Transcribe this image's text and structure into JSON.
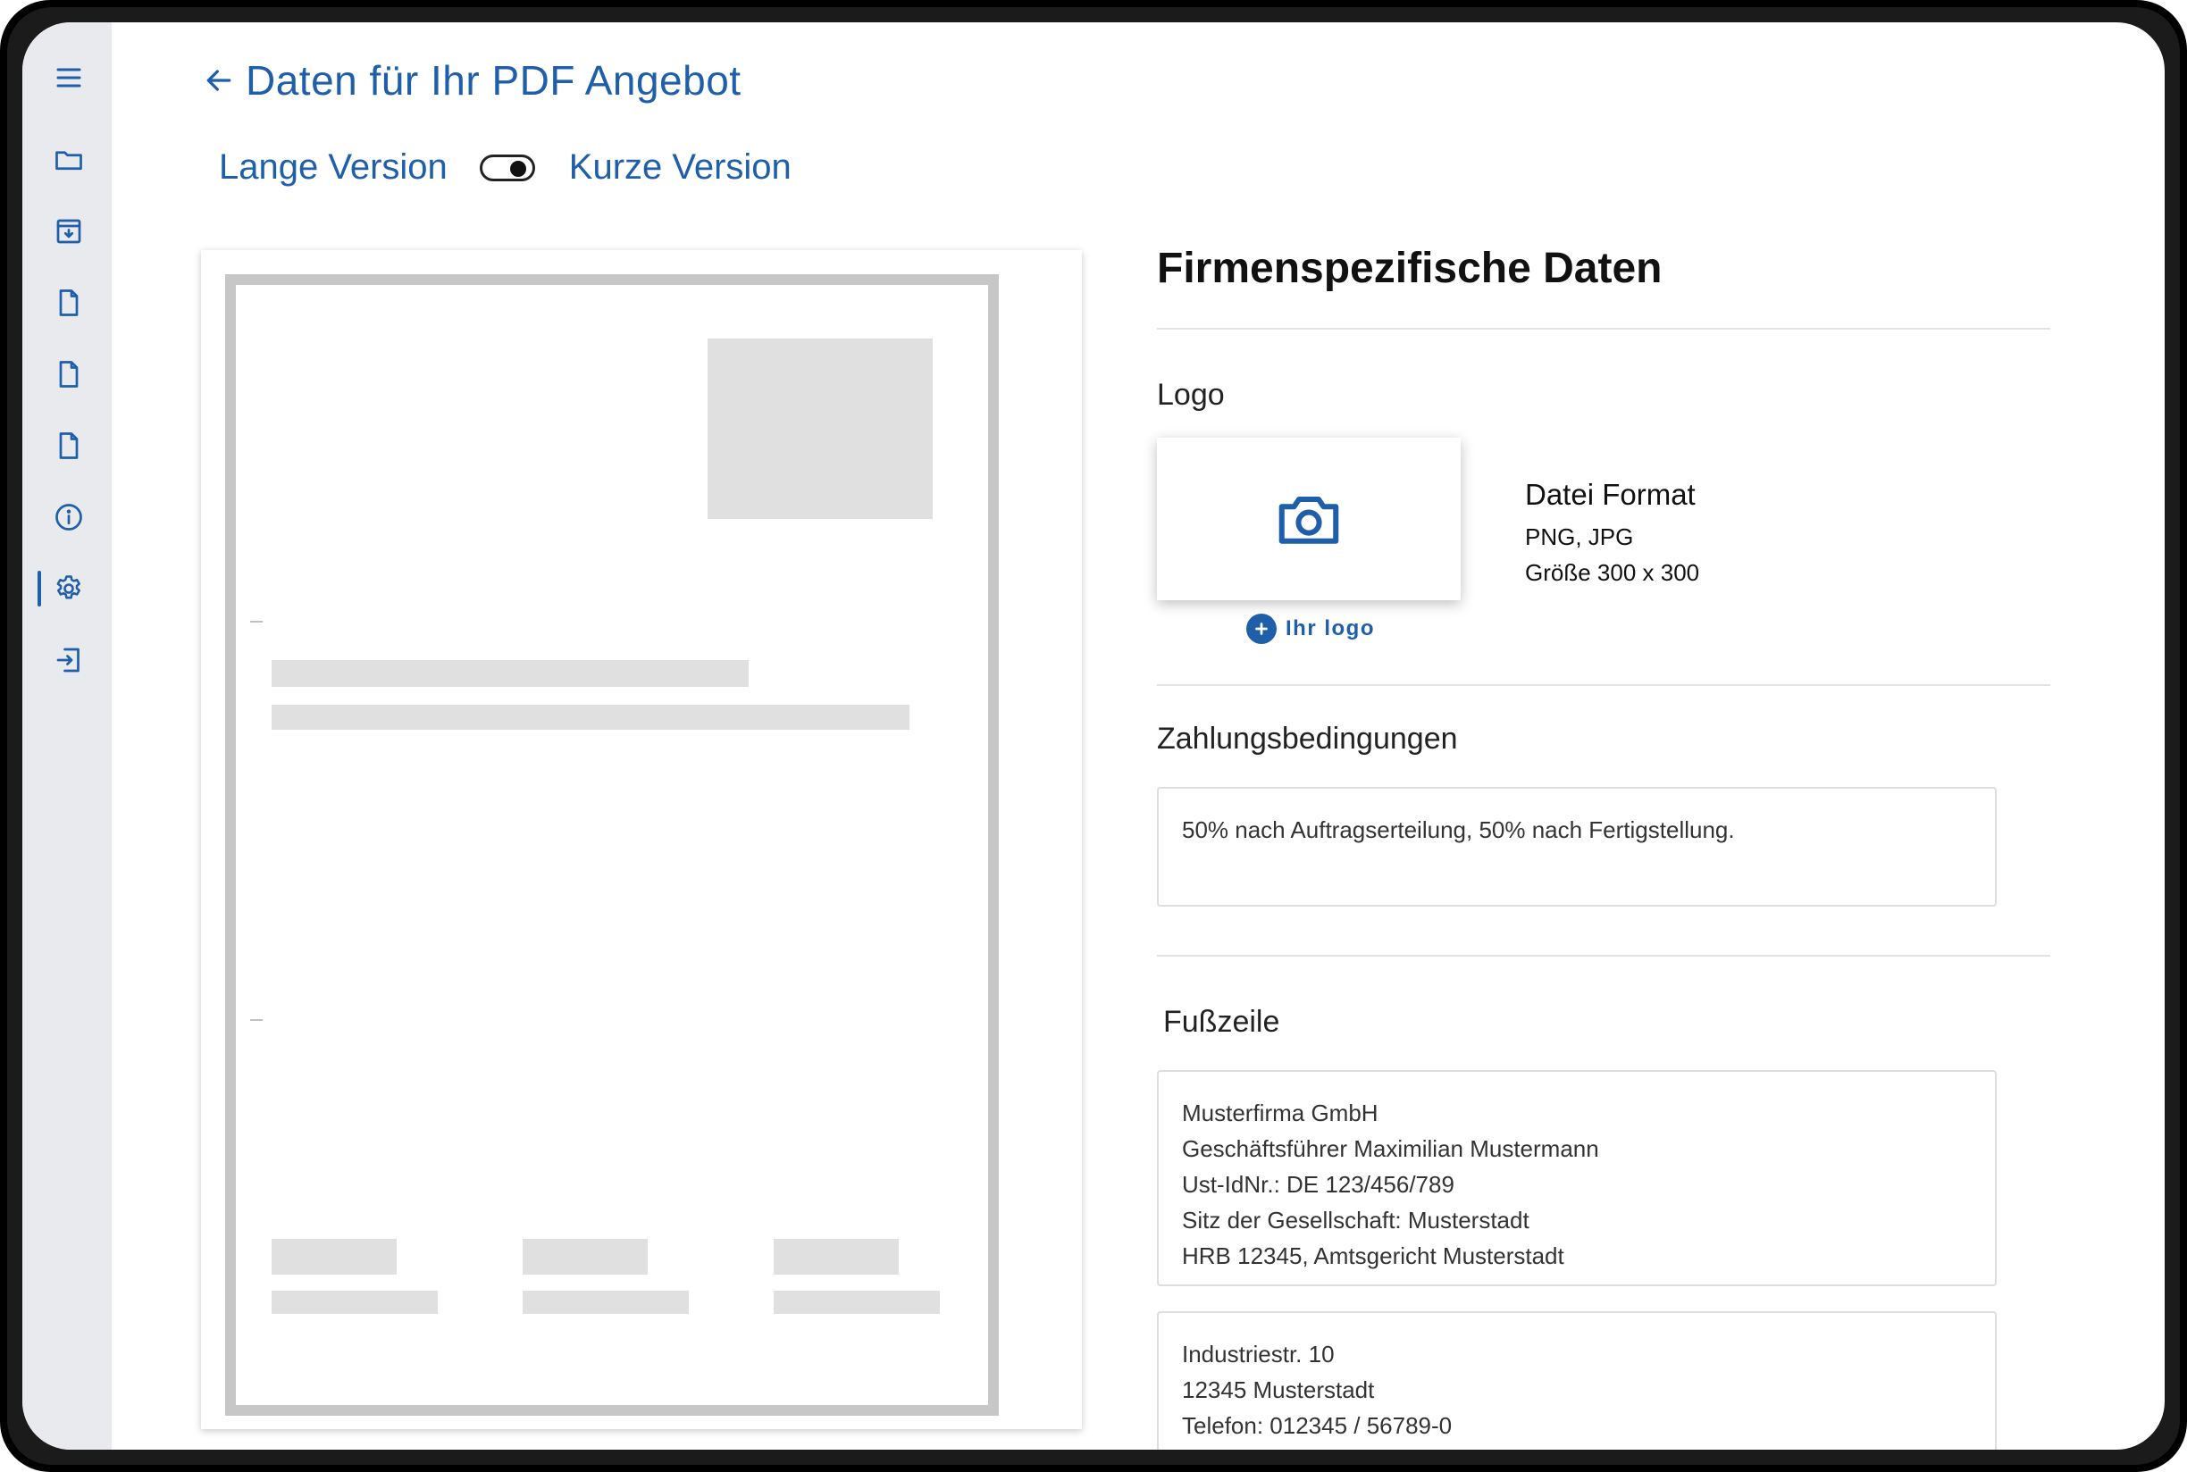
{
  "header": {
    "title": "Daten für Ihr PDF Angebot"
  },
  "version_toggle": {
    "left_label": "Lange Version",
    "right_label": "Kurze Version",
    "selected": "Kurze Version"
  },
  "sidebar": {
    "items": [
      {
        "icon": "menu-icon"
      },
      {
        "icon": "folder-icon"
      },
      {
        "icon": "archive-icon"
      },
      {
        "icon": "document-icon"
      },
      {
        "icon": "document-icon"
      },
      {
        "icon": "document-icon"
      },
      {
        "icon": "info-icon"
      },
      {
        "icon": "gear-icon",
        "active": true
      },
      {
        "icon": "logout-icon"
      }
    ]
  },
  "company": {
    "section_title": "Firmenspezifische Daten",
    "logo_label": "Logo",
    "add_logo_label": "Ihr logo",
    "file_format_title": "Datei Format",
    "file_types": "PNG, JPG",
    "file_size": "Größe 300 x 300",
    "payment_label": "Zahlungsbedingungen",
    "payment_text": "50% nach Auftragserteilung, 50% nach Fertigstellung.",
    "footer_label": "Fußzeile",
    "footer_box1": [
      "Musterfirma GmbH",
      "Geschäftsführer Maximilian Mustermann",
      "Ust-IdNr.: DE 123/456/789",
      "Sitz der Gesellschaft: Musterstadt",
      "HRB 12345, Amtsgericht Musterstadt"
    ],
    "footer_box2": [
      "Industriestr. 10",
      "12345 Musterstadt",
      "Telefon: 012345 / 56789-0"
    ]
  },
  "colors": {
    "accent": "#1f5ea8",
    "sidebar_bg": "#e8eaee",
    "skeleton": "#e0e0e0"
  }
}
